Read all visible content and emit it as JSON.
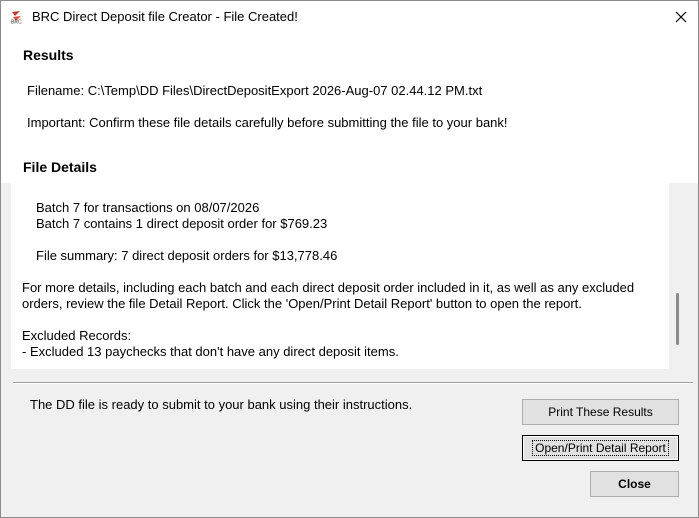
{
  "window": {
    "title": "BRC Direct Deposit file Creator - File Created!",
    "icon": "brc-app-icon",
    "close_icon": "close-icon"
  },
  "results": {
    "heading": "Results",
    "filename": "Filename: C:\\Temp\\DD Files\\DirectDepositExport 2026-Aug-07 02.44.12 PM.txt",
    "important": "Important: Confirm these file details carefully before submitting the file to your bank!"
  },
  "file_details": {
    "heading": "File Details",
    "lines": [
      "Batch 7 for transactions on 08/07/2026",
      "Batch 7 contains 1 direct deposit order for $769.23",
      "File summary: 7 direct deposit orders for $13,778.46",
      "For more details, including each batch and each direct deposit order included in it, as well as any excluded",
      "orders, review the file Detail Report. Click the 'Open/Print Detail Report' button to open the report.",
      "Excluded Records:",
      "- Excluded 13 paychecks that don't have any direct deposit items."
    ]
  },
  "status": "The DD file is ready to submit to your bank using their instructions.",
  "buttons": {
    "print": "Print These Results",
    "detail": "Open/Print Detail Report",
    "close": "Close"
  }
}
